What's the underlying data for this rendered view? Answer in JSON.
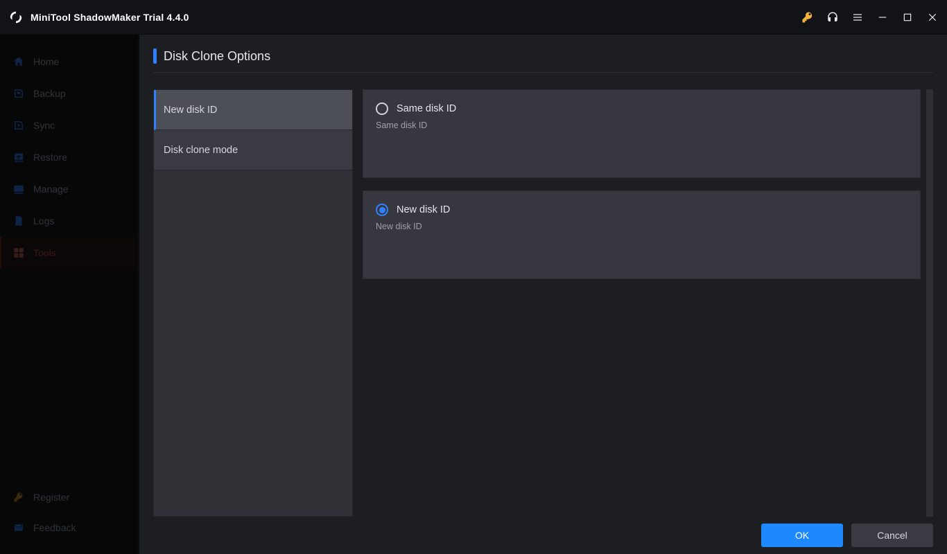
{
  "app": {
    "title": "MiniTool ShadowMaker Trial 4.4.0"
  },
  "sidebar": {
    "items": [
      {
        "label": "Home"
      },
      {
        "label": "Backup"
      },
      {
        "label": "Sync"
      },
      {
        "label": "Restore"
      },
      {
        "label": "Manage"
      },
      {
        "label": "Logs"
      },
      {
        "label": "Tools"
      }
    ],
    "bottom": [
      {
        "label": "Register"
      },
      {
        "label": "Feedback"
      }
    ]
  },
  "page": {
    "title": "Disk Clone Options",
    "tabs": [
      {
        "label": "New disk ID"
      },
      {
        "label": "Disk clone mode"
      }
    ],
    "options": [
      {
        "title": "Same disk ID",
        "desc": "Same disk ID",
        "selected": false
      },
      {
        "title": "New disk ID",
        "desc": "New disk ID",
        "selected": true
      }
    ],
    "buttons": {
      "ok": "OK",
      "cancel": "Cancel"
    }
  }
}
